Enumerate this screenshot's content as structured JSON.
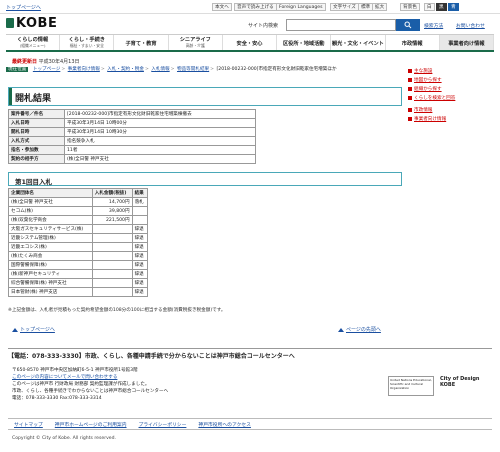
{
  "top": {
    "link": "トップページへ",
    "utils": [
      "本文へ",
      "音声で読み上げる",
      "Foreign Languages",
      "文字サイズ",
      "標準",
      "拡大",
      "背景色",
      "白",
      "黒",
      "青"
    ]
  },
  "header": {
    "logo": "KOBE",
    "search_label": "サイト内検索",
    "search_button_icon": "search-icon",
    "links": [
      "検索方法",
      "お問い合わせ"
    ]
  },
  "nav": [
    {
      "main": "くらしの情報",
      "sub": "(組織メニュー)"
    },
    {
      "main": "くらし・手続き",
      "sub": "福祉・すまい・安全"
    },
    {
      "main": "子育て・教育",
      "sub": ""
    },
    {
      "main": "シニアライフ",
      "sub": "高齢・介護"
    },
    {
      "main": "安全・安心",
      "sub": ""
    },
    {
      "main": "区役所・地域活動",
      "sub": ""
    },
    {
      "main": "観光・文化・イベント",
      "sub": ""
    },
    {
      "main": "市政情報",
      "sub": ""
    },
    {
      "main": "事業者向け情報",
      "sub": ""
    }
  ],
  "updated": {
    "label": "最終更新日",
    "date": "平成30年4月13日"
  },
  "breadcrumb": {
    "here": "現在位置",
    "items": [
      "トップページ",
      "事業者向け情報",
      "入札・契約・税金",
      "入札情報",
      "物品等開札結果",
      "[2018-00232-000]市指定有形文化財旧乾家住宅増築ほか"
    ]
  },
  "sidebar": [
    "主な施設",
    "地図から探す",
    "組織から探す",
    "くらしを検索と回答",
    "市政情報",
    "事業者向け情報"
  ],
  "page_title": "開札結果",
  "info": [
    {
      "k": "案件番号／件名",
      "v": "[2018-00232-000]市指定有形文化財旧乾家住宅増築棟撤去"
    },
    {
      "k": "入札日時",
      "v": "平成30年3月14日 10時00分"
    },
    {
      "k": "開札日時",
      "v": "平成30年3月14日 10時30分"
    },
    {
      "k": "入札方式",
      "v": "指名競争入札"
    },
    {
      "k": "指名・参加数",
      "v": "11者"
    },
    {
      "k": "契約の相手方",
      "v": "(株)全日警 神戸支社"
    }
  ],
  "round_title": "第1回目入札",
  "results": {
    "headers": [
      "企業団体名",
      "入札金額(税抜)",
      "結果"
    ],
    "rows": [
      [
        "(株)全日警 神戸支社",
        "14,700円",
        "落札"
      ],
      [
        "セコム(株)",
        "39,800円",
        ""
      ],
      [
        "(株)双葉化学商会",
        "221,500円",
        ""
      ],
      [
        "大阪ガスセキュリティサービス(株)",
        "",
        "辞退"
      ],
      [
        "近畿システム管理(株)",
        "",
        "辞退"
      ],
      [
        "近畿エコシス(株)",
        "",
        "辞退"
      ],
      [
        "(株)たくみ商会",
        "",
        "辞退"
      ],
      [
        "国際警備保障(株)",
        "",
        "辞退"
      ],
      [
        "(株)新神戸セキュリティ",
        "",
        "辞退"
      ],
      [
        "綜合警備保障(株) 神戸支社",
        "",
        "辞退"
      ],
      [
        "日本管財(株) 神戸支店",
        "",
        "辞退"
      ]
    ]
  },
  "note": "※上記金額は、入札者が見積もった契約希望金額の108分の100に相当する金額(消費税抜き税金額)です。",
  "pager": {
    "top": "トップページへ",
    "pagetop": "ページの先頭へ"
  },
  "call": "【電話：078-333-3330】市政、くらし、各種申請手続で分からないことは神戸市総合コールセンターへ",
  "address": [
    "〒650-8570 神戸市中央区加納町6-5-1 神戸市役所1号館3階",
    "このページの内容についてメールで問い合わせする",
    "このページは神戸市 行財政局 財務部 契約監理課が作成しました。",
    "市政、くらし、各種手続きでわからないことは神戸市総合コールセンターへ",
    "電話：078-333-3330 Fax:078-333-3314"
  ],
  "logos": {
    "unesco": "United Nations Educational, Scientific and Cultural Organization",
    "city": "City of Design KOBE"
  },
  "footer_links": [
    "サイトマップ",
    "神戸市ホームページのご利用案内",
    "プライバシーポリシー",
    "神戸市役所へのアクセス"
  ],
  "copyright": "Copyright © City of Kobe. All rights reserved."
}
